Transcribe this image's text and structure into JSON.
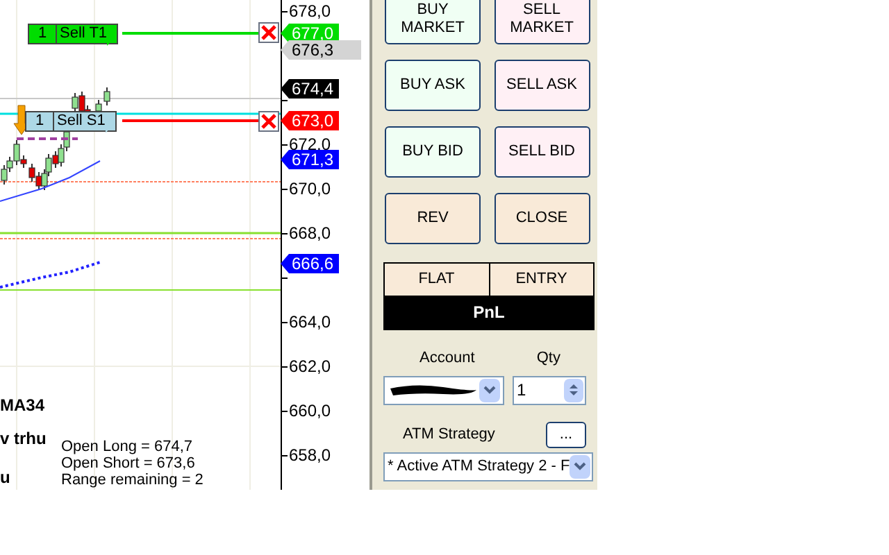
{
  "chart": {
    "price_axis": {
      "ticks": [
        "678,0",
        "672,0",
        "670,0",
        "668,0",
        "664,0",
        "662,0",
        "660,0",
        "658,0"
      ]
    },
    "orders": [
      {
        "kind": "target",
        "quantity": "1",
        "label": "Sell T1"
      },
      {
        "kind": "stop",
        "quantity": "1",
        "label": "Sell S1"
      }
    ],
    "price_markers": [
      {
        "text": "677,0",
        "color": "#00dd00"
      },
      {
        "text": "676,3",
        "color": "#d4d4d4"
      },
      {
        "text": "674,4",
        "color": "#000000"
      },
      {
        "text": "673,0",
        "color": "#ff0000"
      },
      {
        "text": "671,3",
        "color": "#0000ff"
      },
      {
        "text": "666,6",
        "color": "#0000ff"
      }
    ],
    "indicator_labels": [
      "MA34",
      "v trhu",
      "u"
    ],
    "stats": [
      "Open Long = 674,7",
      "Open Short = 673,6",
      "Range remaining = 2"
    ]
  },
  "panel": {
    "buttons": [
      {
        "label": "BUY MARKET",
        "kind": "buy"
      },
      {
        "label": "SELL MARKET",
        "kind": "sell"
      },
      {
        "label": "BUY ASK",
        "kind": "buy"
      },
      {
        "label": "SELL ASK",
        "kind": "sell"
      },
      {
        "label": "BUY BID",
        "kind": "buy"
      },
      {
        "label": "SELL BID",
        "kind": "sell"
      },
      {
        "label": "REV",
        "kind": "neutral"
      },
      {
        "label": "CLOSE",
        "kind": "neutral"
      }
    ],
    "position_cells": [
      "FLAT",
      "ENTRY"
    ],
    "pnl": "PnL",
    "account_label": "Account",
    "qty_label": "Qty",
    "qty_value": "1",
    "atm_label": "ATM Strategy",
    "atm_button": "...",
    "atm_value": "* Active ATM Strategy 2 - F"
  }
}
